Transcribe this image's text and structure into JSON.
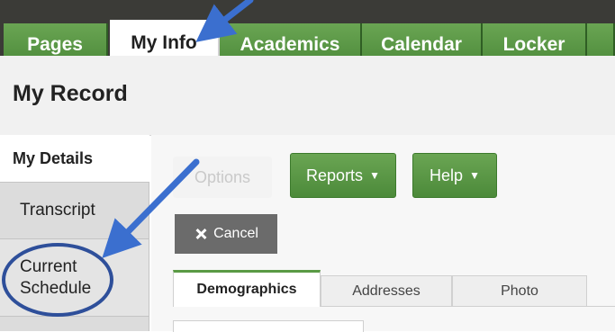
{
  "tabs": [
    {
      "label": "Pages",
      "active": false
    },
    {
      "label": "My Info",
      "active": true
    },
    {
      "label": "Academics",
      "active": false
    },
    {
      "label": "Calendar",
      "active": false
    },
    {
      "label": "Locker",
      "active": false
    },
    {
      "label": "",
      "active": false
    }
  ],
  "page": {
    "title": "My Record"
  },
  "sidebar": {
    "items": [
      {
        "label": "My Details"
      },
      {
        "label": "Transcript"
      },
      {
        "label": "Current\nSchedule"
      },
      {
        "label": ""
      }
    ]
  },
  "toolbar": {
    "options_label": "Options",
    "reports_label": "Reports",
    "help_label": "Help",
    "cancel_label": "Cancel"
  },
  "subtabs": [
    {
      "label": "Demographics",
      "active": true
    },
    {
      "label": "Addresses",
      "active": false
    },
    {
      "label": "Photo",
      "active": false
    }
  ],
  "colors": {
    "tab_green": "#5a9a45",
    "annotation_blue": "#3b6fcf",
    "cancel_gray": "#6b6b6b"
  }
}
